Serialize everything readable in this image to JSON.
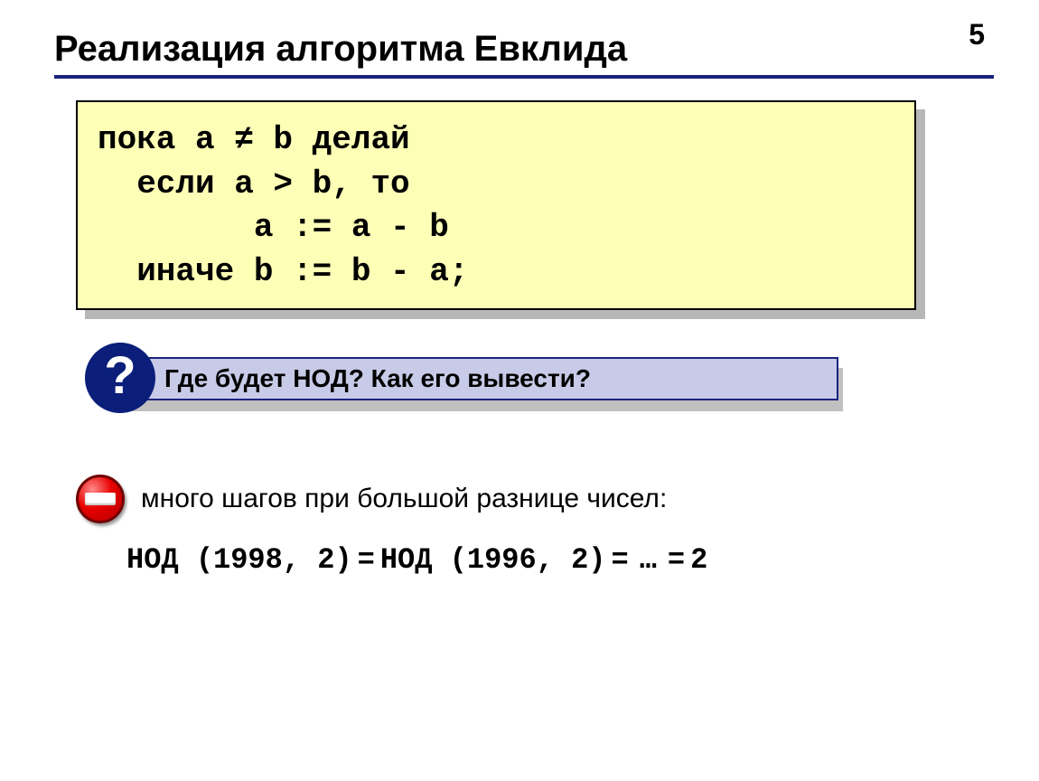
{
  "page_number": "5",
  "title": "Реализация алгоритма Евклида",
  "code": {
    "line1": "пока a ≠ b делай",
    "line2": "  если a > b, то",
    "line3": "        a := a - b",
    "line4": "  иначе b := b - a;"
  },
  "question": {
    "icon": "?",
    "text": "Где будет НОД? Как его вывести?"
  },
  "note": {
    "text": "много шагов при большой разнице чисел:",
    "nod1": "НОД (1998, 2)",
    "eq": "=",
    "nod2": "НОД (1996, 2)",
    "dots": "…",
    "res": "2"
  }
}
